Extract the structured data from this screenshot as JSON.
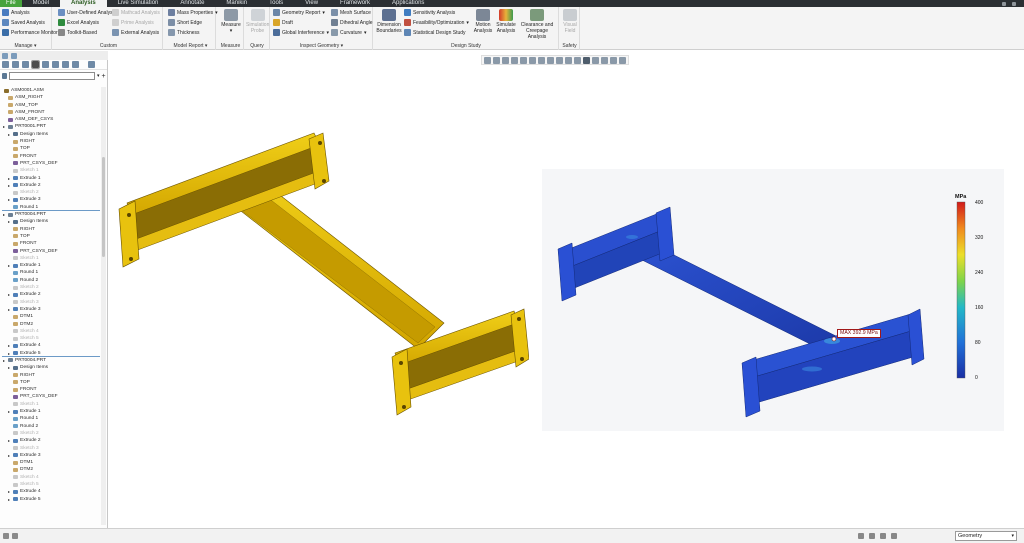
{
  "menu": {
    "tabs": [
      "File",
      "Model",
      "Analysis",
      "Live Simulation",
      "Annotate",
      "Manikin",
      "Tools",
      "View",
      "Framework",
      "Applications"
    ],
    "active": "Analysis"
  },
  "ribbon": {
    "manage": {
      "label": "Manage",
      "items": [
        "Analysis",
        "Saved Analysis",
        "Performance Monitor"
      ]
    },
    "custom": {
      "label": "Custom",
      "items": [
        "User-Defined Analysis",
        "Excel Analysis",
        "Toolkit-Based",
        "Mathcad Analysis",
        "Prime Analysis",
        "External Analysis"
      ]
    },
    "model_report": {
      "label": "Model Report",
      "items": [
        "Mass Properties",
        "Short Edge",
        "Thickness"
      ]
    },
    "measure": {
      "label": "Measure",
      "button": "Measure"
    },
    "query": {
      "label": "Query",
      "button": "Simulation Probe"
    },
    "inspect": {
      "label": "Inspect Geometry",
      "items": [
        "Geometry Report",
        "Draft",
        "Global Interference",
        "Mesh Surface",
        "Dihedral Angle",
        "Curvature"
      ]
    },
    "design_study": {
      "label": "Design Study",
      "dim": "Dimension Boundaries",
      "items": [
        "Sensitivity Analysis",
        "Feasibility/Optimization",
        "Statistical Design Study"
      ],
      "buttons": [
        "Motion Analysis",
        "Simulate Analysis",
        "Clearance and Creepage Analysis"
      ]
    },
    "safety": {
      "label": "Safety",
      "button": "Visual Field"
    }
  },
  "tree": [
    {
      "t": "ASM0001.ASM",
      "lvl": 0,
      "k": "asm"
    },
    {
      "t": "ASM_RIGHT",
      "lvl": 1,
      "k": "plane"
    },
    {
      "t": "ASM_TOP",
      "lvl": 1,
      "k": "plane"
    },
    {
      "t": "ASM_FRONT",
      "lvl": 1,
      "k": "plane"
    },
    {
      "t": "ASM_DEF_CSYS",
      "lvl": 1,
      "k": "csys"
    },
    {
      "t": "PRT0001.PRT",
      "lvl": 1,
      "k": "part"
    },
    {
      "t": "Design Items",
      "lvl": 2,
      "k": "folder"
    },
    {
      "t": "RIGHT",
      "lvl": 2,
      "k": "plane"
    },
    {
      "t": "TOP",
      "lvl": 2,
      "k": "plane"
    },
    {
      "t": "FRONT",
      "lvl": 2,
      "k": "plane"
    },
    {
      "t": "PRT_CSYS_DEF",
      "lvl": 2,
      "k": "csys"
    },
    {
      "t": "Sketch 1",
      "lvl": 2,
      "k": "dim"
    },
    {
      "t": "Extrude 1",
      "lvl": 2,
      "k": "feat"
    },
    {
      "t": "Extrude 2",
      "lvl": 2,
      "k": "feat"
    },
    {
      "t": "Sketch 2",
      "lvl": 2,
      "k": "dim"
    },
    {
      "t": "Extrude 3",
      "lvl": 2,
      "k": "feat"
    },
    {
      "t": "Round 1",
      "lvl": 2,
      "k": "round",
      "sep": true
    },
    {
      "t": "PRT0004.PRT",
      "lvl": 1,
      "k": "part"
    },
    {
      "t": "Design Items",
      "lvl": 2,
      "k": "folder"
    },
    {
      "t": "RIGHT",
      "lvl": 2,
      "k": "plane"
    },
    {
      "t": "TOP",
      "lvl": 2,
      "k": "plane"
    },
    {
      "t": "FRONT",
      "lvl": 2,
      "k": "plane"
    },
    {
      "t": "PRT_CSYS_DEF",
      "lvl": 2,
      "k": "csys"
    },
    {
      "t": "Sketch 1",
      "lvl": 2,
      "k": "dim"
    },
    {
      "t": "Extrude 1",
      "lvl": 2,
      "k": "feat"
    },
    {
      "t": "Round 1",
      "lvl": 2,
      "k": "round"
    },
    {
      "t": "Round 2",
      "lvl": 2,
      "k": "round"
    },
    {
      "t": "Sketch 2",
      "lvl": 2,
      "k": "dim"
    },
    {
      "t": "Extrude 2",
      "lvl": 2,
      "k": "feat"
    },
    {
      "t": "Sketch 3",
      "lvl": 2,
      "k": "dim"
    },
    {
      "t": "Extrude 3",
      "lvl": 2,
      "k": "feat"
    },
    {
      "t": "DTM1",
      "lvl": 2,
      "k": "plane"
    },
    {
      "t": "DTM2",
      "lvl": 2,
      "k": "plane"
    },
    {
      "t": "Sketch 4",
      "lvl": 2,
      "k": "dim"
    },
    {
      "t": "Sketch 5",
      "lvl": 2,
      "k": "dim"
    },
    {
      "t": "Extrude 4",
      "lvl": 2,
      "k": "feat"
    },
    {
      "t": "Extrude 5",
      "lvl": 2,
      "k": "feat",
      "sep": true
    },
    {
      "t": "PRT0004.PRT",
      "lvl": 1,
      "k": "part"
    },
    {
      "t": "Design Items",
      "lvl": 2,
      "k": "folder"
    },
    {
      "t": "RIGHT",
      "lvl": 2,
      "k": "plane"
    },
    {
      "t": "TOP",
      "lvl": 2,
      "k": "plane"
    },
    {
      "t": "FRONT",
      "lvl": 2,
      "k": "plane"
    },
    {
      "t": "PRT_CSYS_DEF",
      "lvl": 2,
      "k": "csys"
    },
    {
      "t": "Sketch 1",
      "lvl": 2,
      "k": "dim"
    },
    {
      "t": "Extrude 1",
      "lvl": 2,
      "k": "feat"
    },
    {
      "t": "Round 1",
      "lvl": 2,
      "k": "round"
    },
    {
      "t": "Round 2",
      "lvl": 2,
      "k": "round"
    },
    {
      "t": "Sketch 2",
      "lvl": 2,
      "k": "dim"
    },
    {
      "t": "Extrude 2",
      "lvl": 2,
      "k": "feat"
    },
    {
      "t": "Sketch 3",
      "lvl": 2,
      "k": "dim"
    },
    {
      "t": "Extrude 3",
      "lvl": 2,
      "k": "feat"
    },
    {
      "t": "DTM1",
      "lvl": 2,
      "k": "plane"
    },
    {
      "t": "DTM2",
      "lvl": 2,
      "k": "plane"
    },
    {
      "t": "Sketch 4",
      "lvl": 2,
      "k": "dim"
    },
    {
      "t": "Sketch 5",
      "lvl": 2,
      "k": "dim"
    },
    {
      "t": "Extrude 4",
      "lvl": 2,
      "k": "feat"
    },
    {
      "t": "Extrude 5",
      "lvl": 2,
      "k": "feat"
    }
  ],
  "result": {
    "unit": "MPa",
    "ticks": [
      "400",
      "320",
      "240",
      "160",
      "80",
      "0"
    ],
    "max_label": "MAX 392.9 MPa"
  },
  "status": {
    "filter": "Geometry"
  },
  "colors": {
    "accent": "#47a33d",
    "part": "#e8c10c",
    "stress_low": "#1f3fb5",
    "stress_high": "#d11a1a"
  }
}
